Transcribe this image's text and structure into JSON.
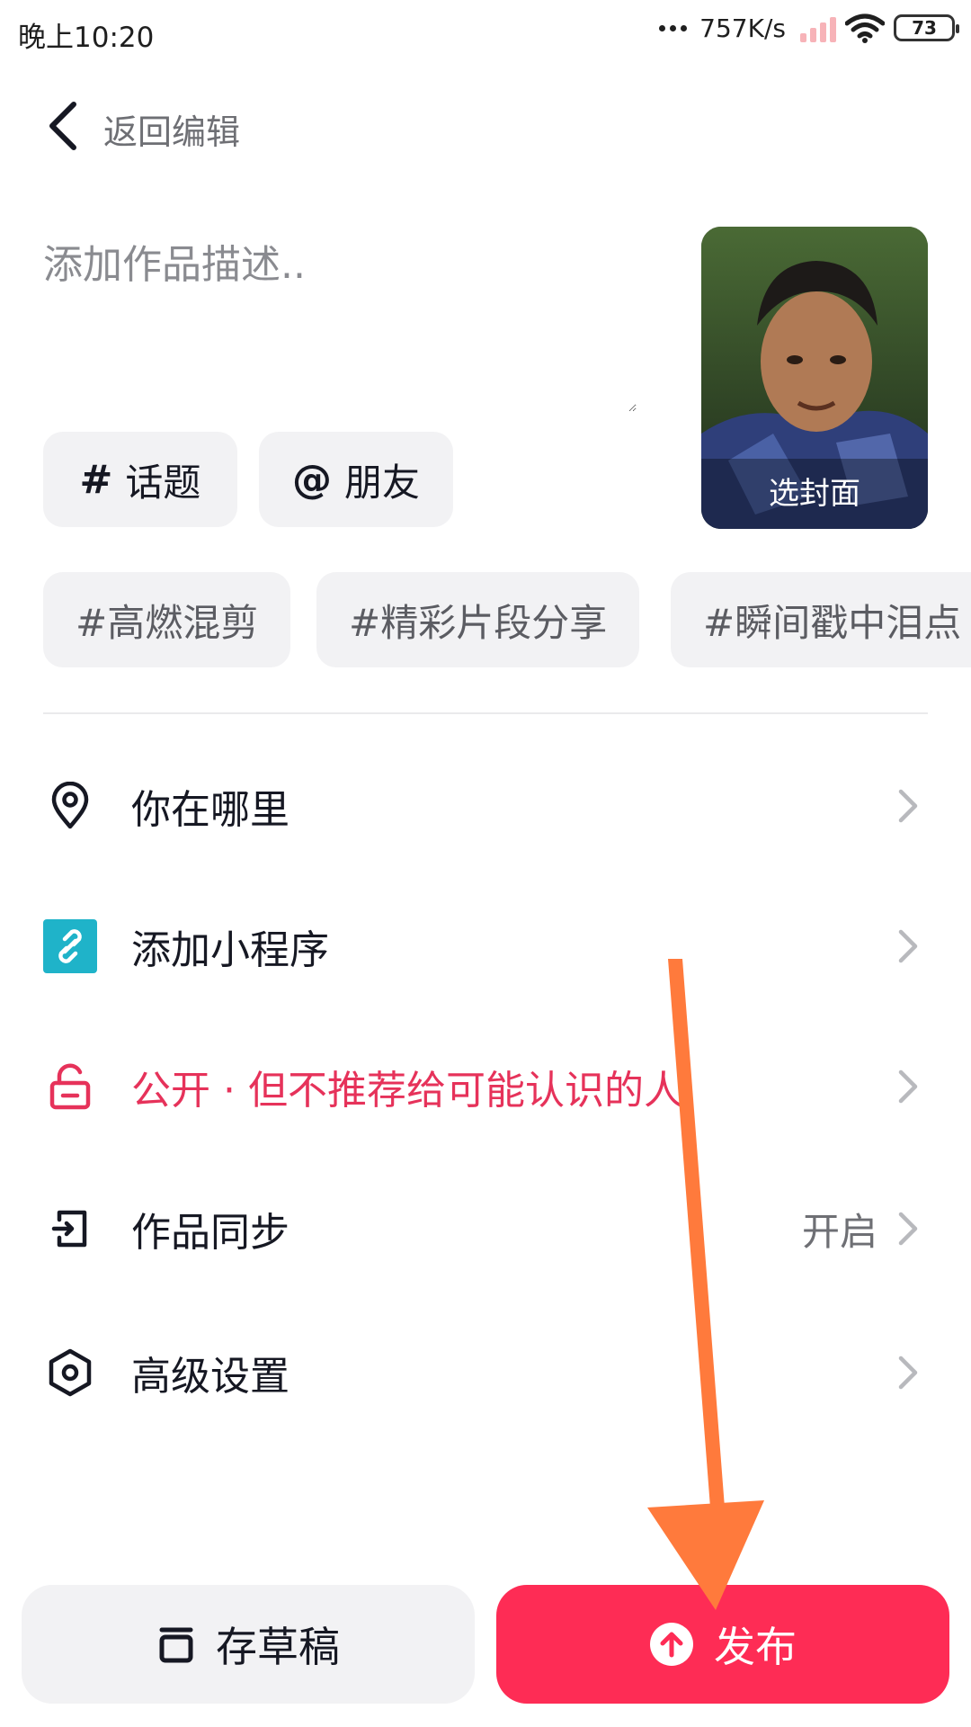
{
  "status_bar": {
    "time": "晚上10:20",
    "network_speed": "757K/s",
    "battery": "73"
  },
  "header": {
    "back_label": "返回编辑"
  },
  "description": {
    "placeholder": "添加作品描述.."
  },
  "cover": {
    "label": "选封面"
  },
  "chips": {
    "topic_symbol": "#",
    "topic_label": "话题",
    "friend_symbol": "@",
    "friend_label": "朋友"
  },
  "suggested_tags": [
    "#高燃混剪",
    "#精彩片段分享",
    "#瞬间戳中泪点"
  ],
  "options": {
    "location": "你在哪里",
    "mini_program": "添加小程序",
    "privacy": "公开 · 但不推荐给可能认识的人",
    "sync_label": "作品同步",
    "sync_value": "开启",
    "advanced": "高级设置"
  },
  "buttons": {
    "draft": "存草稿",
    "publish": "发布"
  },
  "colors": {
    "accent": "#fe2c55",
    "privacy_text": "#e6325a",
    "mini_program_icon": "#1fb3c9",
    "annotation_arrow": "#ff7a3c"
  }
}
